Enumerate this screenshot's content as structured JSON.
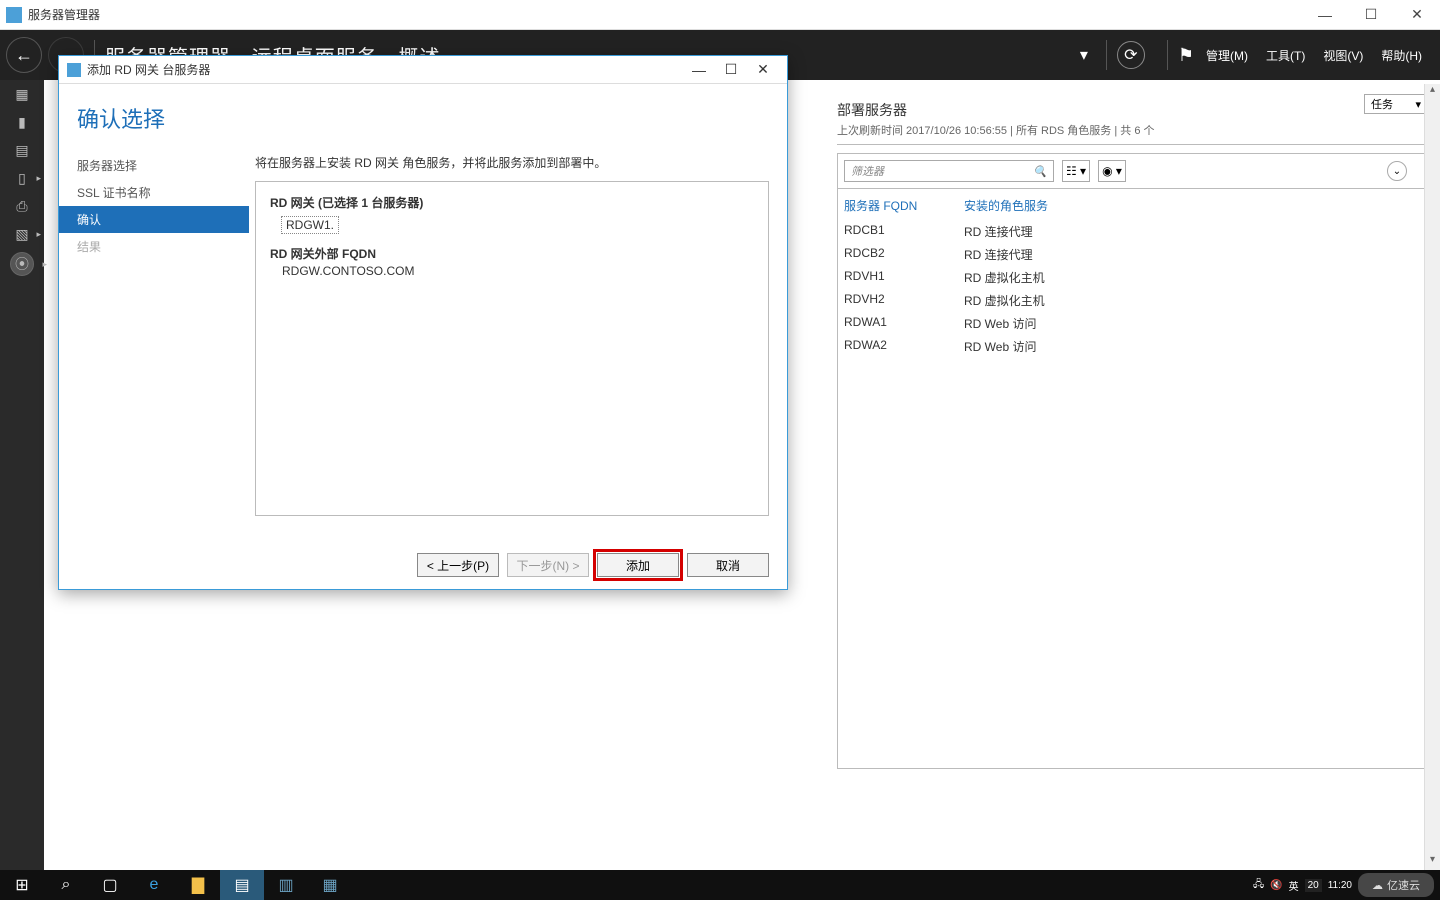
{
  "app": {
    "title": "服务器管理器"
  },
  "window_buttons": {
    "min": "—",
    "max": "☐",
    "close": "✕"
  },
  "sm": {
    "breadcrumb": "服务器管理器 · 远程桌面服务 · 概述",
    "menu": {
      "manage": "管理(M)",
      "tools": "工具(T)",
      "view": "视图(V)",
      "help": "帮助(H)"
    },
    "caret": "▾"
  },
  "right_panel": {
    "title": "部署服务器",
    "sub": "上次刷新时间 2017/10/26 10:56:55 | 所有 RDS 角色服务 | 共 6 个",
    "tasks": "任务",
    "filter_placeholder": "筛选器",
    "col1": "服务器 FQDN",
    "col2": "安装的角色服务",
    "rows": [
      {
        "fqdn": "RDCB1",
        "role": "RD 连接代理"
      },
      {
        "fqdn": "RDCB2",
        "role": "RD 连接代理"
      },
      {
        "fqdn": "RDVH1",
        "role": "RD 虚拟化主机"
      },
      {
        "fqdn": "RDVH2",
        "role": "RD 虚拟化主机"
      },
      {
        "fqdn": "RDWA1",
        "role": "RD Web 访问"
      },
      {
        "fqdn": "RDWA2",
        "role": "RD Web 访问"
      }
    ]
  },
  "dialog": {
    "title": "添加 RD 网关 台服务器",
    "heading": "确认选择",
    "nav": {
      "server": "服务器选择",
      "ssl": "SSL 证书名称",
      "confirm": "确认",
      "result": "结果"
    },
    "desc": "将在服务器上安装 RD 网关 角色服务，并将此服务添加到部署中。",
    "gw_heading": "RD 网关  (已选择 1 台服务器)",
    "gw_server": "RDGW1.",
    "fqdn_heading": "RD 网关外部 FQDN",
    "fqdn_value": "RDGW.CONTOSO.COM",
    "btn_prev": "< 上一步(P)",
    "btn_next": "下一步(N) >",
    "btn_add": "添加",
    "btn_cancel": "取消"
  },
  "taskbar": {
    "ime": "英",
    "time": "11:20",
    "watermark": "亿速云",
    "pagecut": "20"
  }
}
